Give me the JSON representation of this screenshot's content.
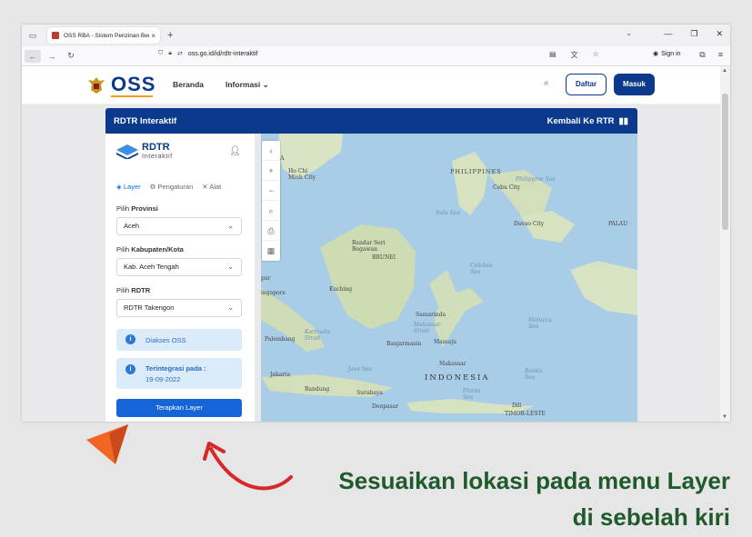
{
  "browser": {
    "tab_title": "OSS RBA - Sistem Perizinan Ber",
    "tab_close": "×",
    "new_tab": "+",
    "url": "oss.go.id/id/rdtr-interaktif",
    "sign_in": "Sign in"
  },
  "header": {
    "logo_text": "OSS",
    "menu": [
      {
        "label": "Beranda"
      },
      {
        "label": "Informasi ⌄"
      }
    ],
    "daftar_label": "Daftar",
    "masuk_label": "Masuk"
  },
  "rdtr_bar": {
    "title": "RDTR Interaktif",
    "back_label": "Kembali Ke RTR"
  },
  "panel": {
    "logo_title": "RDTR",
    "logo_subtitle": "Interaktif",
    "tabs": [
      {
        "label": "Layer",
        "icon": "layers-icon",
        "active": true
      },
      {
        "label": "Pengaturan",
        "icon": "gear-icon",
        "active": false
      },
      {
        "label": "Alat",
        "icon": "tools-icon",
        "active": false
      }
    ],
    "provinsi_prefix": "Pilih",
    "provinsi_label": "Provinsi",
    "provinsi_value": "Aceh",
    "kabupaten_prefix": "Pilih",
    "kabupaten_label": "Kabupaten/Kota",
    "kabupaten_value": "Kab. Aceh Tengah",
    "rdtr_prefix": "Pilih",
    "rdtr_label": "RDTR",
    "rdtr_value": "RDTR Takengon",
    "info_oss": "Diakses OSS",
    "info_integrasi_title": "Terintegrasi pada :",
    "info_integrasi_date": "19-09-2022",
    "apply_label": "Terapkan Layer"
  },
  "map": {
    "labels": [
      {
        "text": "PHILIPPINES",
        "type": "country"
      },
      {
        "text": "Philippine Sea",
        "type": "sea"
      },
      {
        "text": "Ho Chi Minh City",
        "type": "city"
      },
      {
        "text": "Cebu City",
        "type": "city"
      },
      {
        "text": "Sulu Sea",
        "type": "sea"
      },
      {
        "text": "Davao City",
        "type": "city"
      },
      {
        "text": "PALAU",
        "type": "country"
      },
      {
        "text": "Bandar Seri Begawan",
        "type": "city"
      },
      {
        "text": "BRUNEI",
        "type": "country"
      },
      {
        "text": "Celebes Sea",
        "type": "sea"
      },
      {
        "text": "Kuching",
        "type": "city"
      },
      {
        "text": "ingapore",
        "type": "city"
      },
      {
        "text": "Samarinda",
        "type": "city"
      },
      {
        "text": "Makassar Strait",
        "type": "sea"
      },
      {
        "text": "Molucca Sea",
        "type": "sea"
      },
      {
        "text": "Palembang",
        "type": "city"
      },
      {
        "text": "Karimata Strait",
        "type": "sea"
      },
      {
        "text": "Banjarmasin",
        "type": "city"
      },
      {
        "text": "Mamuju",
        "type": "city"
      },
      {
        "text": "Makassar",
        "type": "city"
      },
      {
        "text": "Java Sea",
        "type": "sea"
      },
      {
        "text": "INDONESIA",
        "type": "big"
      },
      {
        "text": "Banda Sea",
        "type": "sea"
      },
      {
        "text": "Jakarta",
        "type": "city"
      },
      {
        "text": "Bandung",
        "type": "city"
      },
      {
        "text": "Surabaya",
        "type": "city"
      },
      {
        "text": "Flores Sea",
        "type": "sea"
      },
      {
        "text": "Denpasar",
        "type": "city"
      },
      {
        "text": "Dili",
        "type": "city"
      },
      {
        "text": "TIMOR-LESTE",
        "type": "country"
      },
      {
        "text": "DIA",
        "type": "city"
      },
      {
        "text": "pur",
        "type": "city"
      }
    ]
  },
  "annotation": {
    "line1": "Sesuaikan lokasi pada menu Layer",
    "line2": "di sebelah kiri",
    "text_color": "#1f5a2c",
    "arrow_color": "#d62828",
    "cursor_color": "#f26522"
  }
}
